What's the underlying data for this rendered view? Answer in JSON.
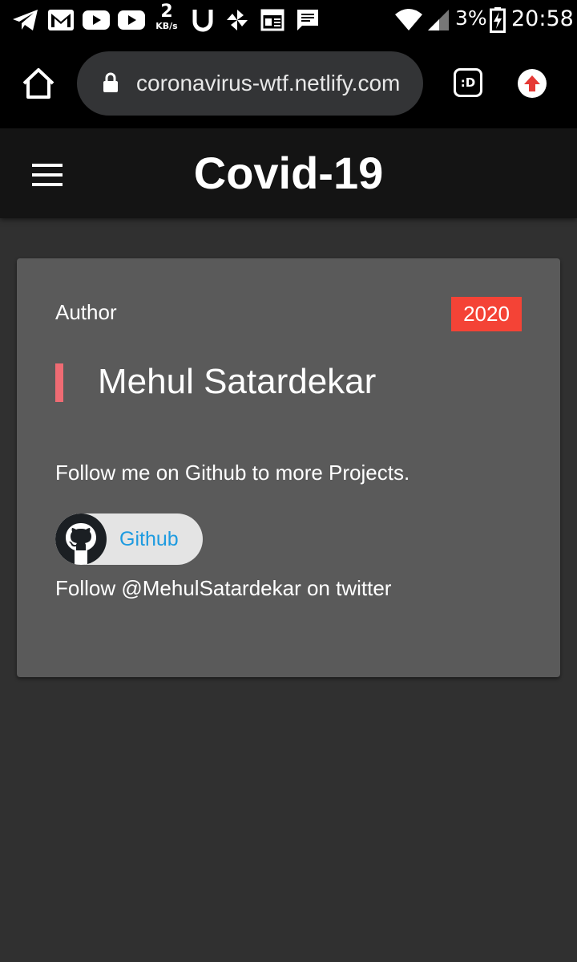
{
  "status_bar": {
    "net_speed_value": "2",
    "net_speed_unit": "KB/s",
    "battery_percent": "3%",
    "time": "20:58",
    "icons": [
      "telegram-icon",
      "gmail-icon",
      "youtube-icon",
      "youtube-icon",
      "u-icon",
      "pinwheel-icon",
      "news-icon",
      "message-icon",
      "wifi-icon",
      "signal-icon",
      "battery-charging-icon"
    ]
  },
  "browser": {
    "url": "coronavirus-wtf.netlify.com",
    "tabs_label": ":D",
    "icons": [
      "home-icon",
      "lock-icon",
      "tabs-icon",
      "upload-icon"
    ]
  },
  "app_bar": {
    "title": "Covid-19",
    "menu_icon": "hamburger-menu-icon"
  },
  "card": {
    "label": "Author",
    "year": "2020",
    "author_name": "Mehul Satardekar",
    "follow_text": "Follow me on Github to more Projects.",
    "github_button_label": "Github",
    "twitter_text": "Follow @MehulSatardekar on twitter"
  },
  "colors": {
    "background": "#303030",
    "app_bar": "#141414",
    "card": "#5a5a5a",
    "badge": "#f44336",
    "quote_bar": "#ef6b73",
    "github_link": "#1e9be0"
  }
}
